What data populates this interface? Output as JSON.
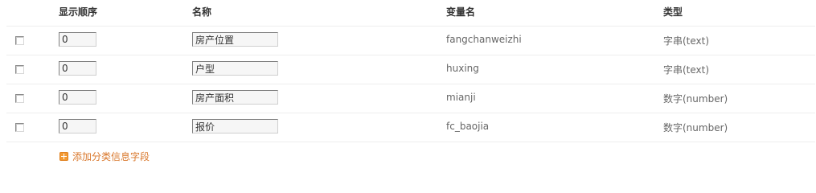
{
  "columns": {
    "order": "显示顺序",
    "name": "名称",
    "variable": "变量名",
    "type": "类型"
  },
  "rows": [
    {
      "checked": false,
      "order": "0",
      "name": "房产位置",
      "variable": "fangchanweizhi",
      "type": "字串(text)"
    },
    {
      "checked": false,
      "order": "0",
      "name": "户型",
      "variable": "huxing",
      "type": "字串(text)"
    },
    {
      "checked": false,
      "order": "0",
      "name": "房产面积",
      "variable": "mianji",
      "type": "数字(number)"
    },
    {
      "checked": false,
      "order": "0",
      "name": "报价",
      "variable": "fc_baojia",
      "type": "数字(number)"
    }
  ],
  "add_link": {
    "label": "添加分类信息字段",
    "icon": "plus-icon",
    "color": "#d9772b"
  }
}
